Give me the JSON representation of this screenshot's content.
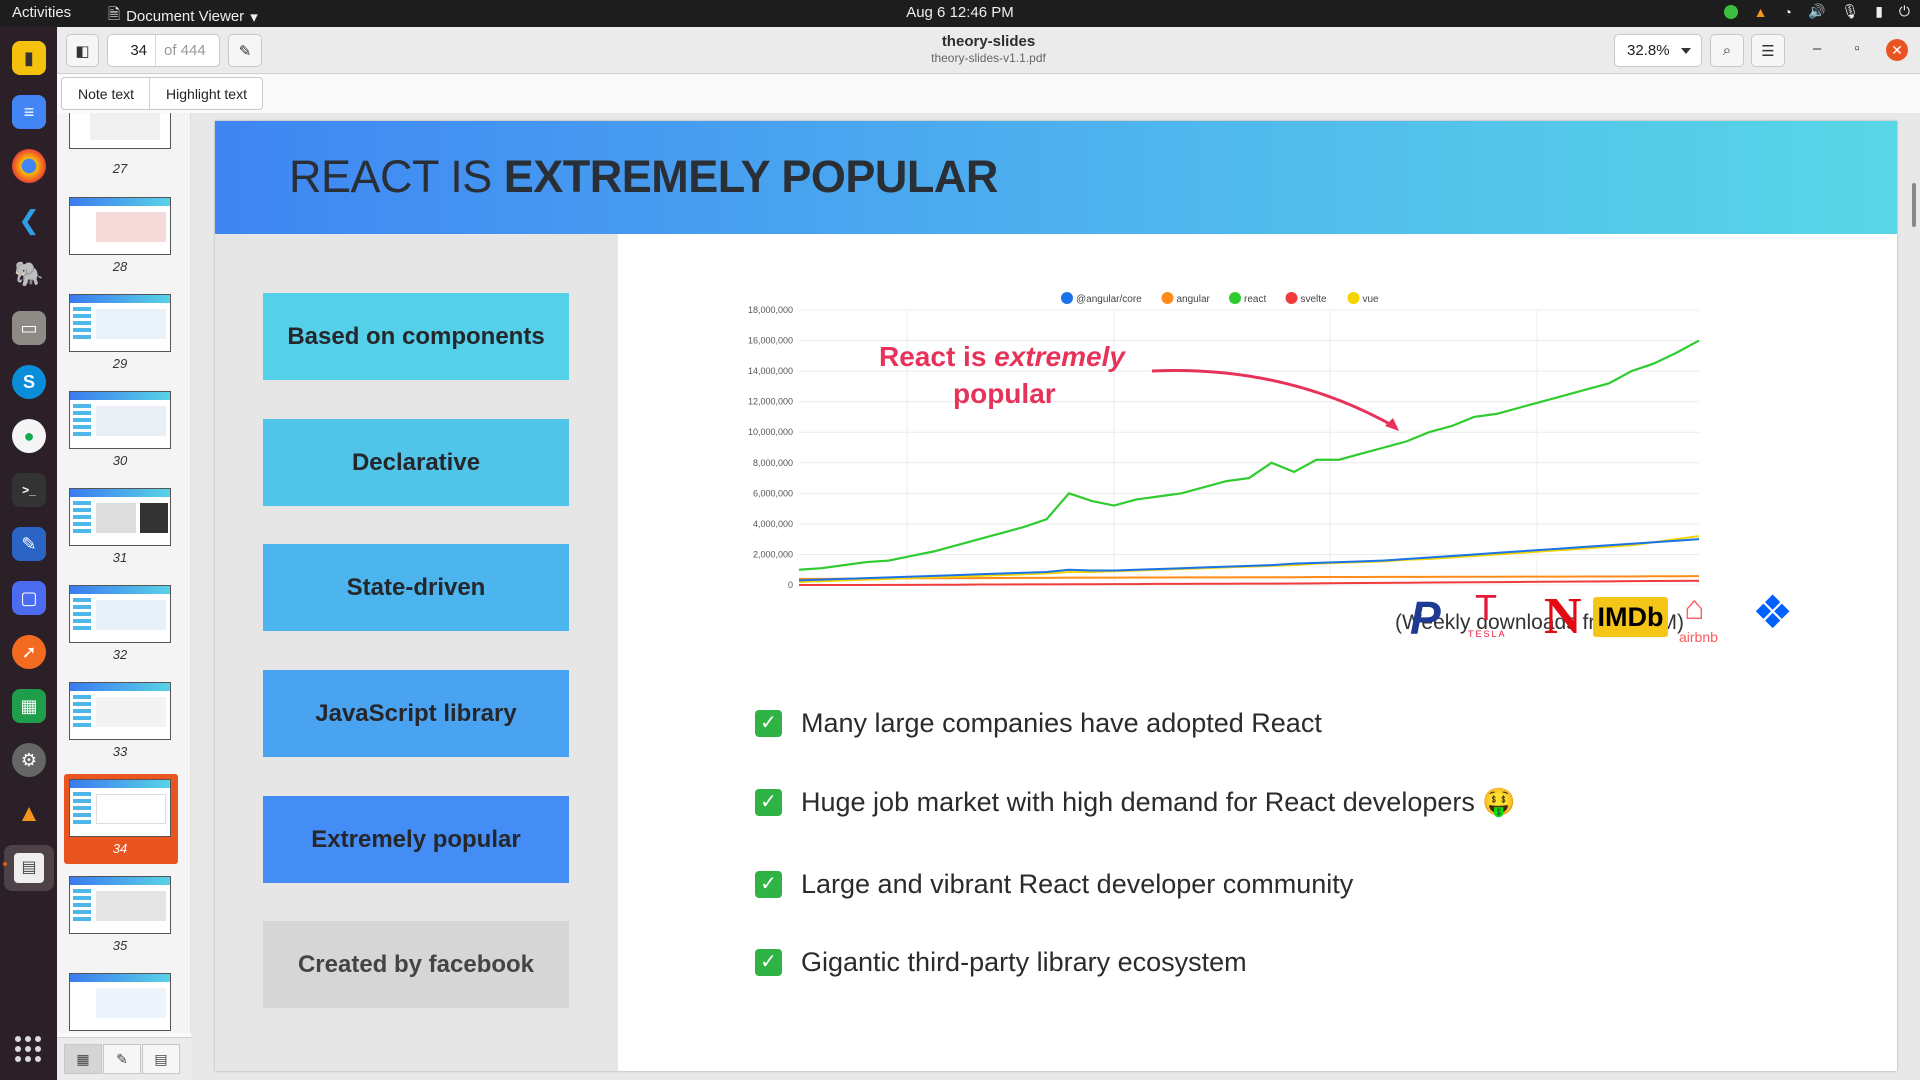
{
  "topbar": {
    "activities": "Activities",
    "app_menu": "Document Viewer",
    "clock": "Aug 6  12:46 PM"
  },
  "header": {
    "page_current": "34",
    "page_total": "of 444",
    "doc_title": "theory-slides",
    "doc_file": "theory-slides-v1.1.pdf",
    "zoom": "32.8%"
  },
  "annotations": {
    "note_label": "Note text",
    "highlight_label": "Highlight text"
  },
  "thumbnails": [
    {
      "num": "27"
    },
    {
      "num": "28"
    },
    {
      "num": "29"
    },
    {
      "num": "30"
    },
    {
      "num": "31"
    },
    {
      "num": "32"
    },
    {
      "num": "33"
    },
    {
      "num": "34",
      "selected": true
    },
    {
      "num": "35"
    }
  ],
  "slide": {
    "title_plain": "REACT IS ",
    "title_bold": "EXTREMELY POPULAR",
    "features": [
      {
        "label": "Based on components",
        "color": "#55d0e9"
      },
      {
        "label": "Declarative",
        "color": "#51c4ea"
      },
      {
        "label": "State-driven",
        "color": "#4db5ee"
      },
      {
        "label": "JavaScript library",
        "color": "#4aa3f1"
      },
      {
        "label": "Extremely popular",
        "color": "#438df4"
      },
      {
        "label": "Created by facebook",
        "color": "#d6d6d6"
      }
    ],
    "chart_caption": "(Weekly downloads from NPM)",
    "annotation_line1": "React is ",
    "annotation_line1_em": "extremely",
    "annotation_line2": "popular",
    "bullets": [
      "Many large companies have adopted React",
      "Huge job market with high demand for React developers 🤑",
      "Large and vibrant React developer community",
      "Gigantic third-party library ecosystem"
    ],
    "logos": [
      "P",
      "TESLA",
      "N",
      "IMDb",
      "airbnb",
      "dropbox"
    ]
  },
  "chart_data": {
    "type": "line",
    "legend": [
      "@angular/core",
      "angular",
      "react",
      "svelte",
      "vue"
    ],
    "legend_colors": [
      "#1a73e8",
      "#ff8c1a",
      "#2ecc2e",
      "#f03c3c",
      "#f5d400"
    ],
    "legend_position": "top",
    "ylim": [
      0,
      18000000
    ],
    "yticks": [
      "0",
      "2,000,000",
      "4,000,000",
      "6,000,000",
      "8,000,000",
      "10,000,000",
      "12,000,000",
      "14,000,000",
      "16,000,000",
      "18,000,000"
    ],
    "x": [
      0,
      1,
      2,
      3,
      4,
      5,
      6,
      7,
      8,
      9,
      10,
      11,
      12,
      13,
      14,
      15,
      16,
      17,
      18,
      19,
      20,
      21,
      22,
      23,
      24,
      25,
      26,
      27,
      28,
      29,
      30,
      31,
      32,
      33,
      34,
      35,
      36,
      37,
      38,
      39,
      40
    ],
    "series": [
      {
        "name": "react",
        "values": [
          1000000,
          1100000,
          1300000,
          1500000,
          1600000,
          1900000,
          2200000,
          2600000,
          3000000,
          3400000,
          3800000,
          4300000,
          6000000,
          5500000,
          5200000,
          5600000,
          5800000,
          6000000,
          6400000,
          6800000,
          7000000,
          8000000,
          7400000,
          8200000,
          8200000,
          8600000,
          9000000,
          9400000,
          10000000,
          10400000,
          11000000,
          11200000,
          11600000,
          12000000,
          12400000,
          12800000,
          13200000,
          14000000,
          14500000,
          15200000,
          16000000
        ]
      },
      {
        "name": "@angular/core",
        "values": [
          300000,
          350000,
          400000,
          450000,
          500000,
          550000,
          600000,
          650000,
          700000,
          750000,
          800000,
          850000,
          1000000,
          950000,
          950000,
          1000000,
          1050000,
          1100000,
          1150000,
          1200000,
          1250000,
          1300000,
          1400000,
          1450000,
          1500000,
          1550000,
          1600000,
          1700000,
          1800000,
          1900000,
          2000000,
          2100000,
          2200000,
          2300000,
          2400000,
          2500000,
          2600000,
          2700000,
          2800000,
          2900000,
          3000000
        ]
      },
      {
        "name": "vue",
        "values": [
          200000,
          250000,
          300000,
          350000,
          400000,
          450000,
          500000,
          550000,
          600000,
          650000,
          700000,
          750000,
          850000,
          850000,
          900000,
          950000,
          1000000,
          1050000,
          1100000,
          1150000,
          1200000,
          1250000,
          1300000,
          1400000,
          1450000,
          1500000,
          1550000,
          1650000,
          1700000,
          1800000,
          1900000,
          2000000,
          2100000,
          2200000,
          2300000,
          2400000,
          2500000,
          2600000,
          2800000,
          3000000,
          3200000
        ]
      },
      {
        "name": "angular",
        "values": [
          400000,
          400000,
          420000,
          420000,
          430000,
          440000,
          440000,
          450000,
          450000,
          460000,
          470000,
          470000,
          480000,
          480000,
          480000,
          490000,
          490000,
          500000,
          500000,
          500000,
          510000,
          510000,
          510000,
          520000,
          520000,
          520000,
          530000,
          530000,
          530000,
          540000,
          540000,
          540000,
          550000,
          550000,
          550000,
          560000,
          560000,
          560000,
          570000,
          570000,
          580000
        ]
      },
      {
        "name": "svelte",
        "values": [
          0,
          0,
          0,
          0,
          10000,
          10000,
          20000,
          20000,
          30000,
          30000,
          40000,
          40000,
          50000,
          50000,
          60000,
          60000,
          70000,
          70000,
          80000,
          80000,
          90000,
          90000,
          100000,
          110000,
          120000,
          130000,
          140000,
          150000,
          160000,
          170000,
          180000,
          190000,
          200000,
          210000,
          220000,
          230000,
          240000,
          250000,
          260000,
          270000,
          280000
        ]
      }
    ]
  }
}
